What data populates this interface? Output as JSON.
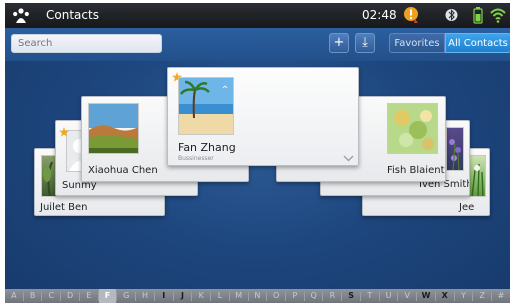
{
  "statusbar": {
    "title": "Contacts",
    "time": "02:48",
    "icons": [
      "contacts-app-icon",
      "alert-icon",
      "bluetooth-icon",
      "battery-icon",
      "wifi-icon"
    ]
  },
  "toolbar": {
    "search_placeholder": "Search",
    "add_label": "+",
    "import_label": "⤓",
    "tabs": [
      {
        "label": "Favorites",
        "selected": false
      },
      {
        "label": "All Contacts",
        "selected": true
      }
    ]
  },
  "contacts": [
    {
      "name": "Fan Zhang",
      "subtitle": "Bussinesser",
      "starred": true,
      "photo": "beach-photo-icon"
    },
    {
      "name": "Xiaohua Chen",
      "starred": false,
      "photo": "landscape-photo-icon"
    },
    {
      "name": "Sunmy",
      "starred": true,
      "photo": "default-avatar-icon"
    },
    {
      "name": "Juilet Ben",
      "starred": false,
      "photo": "plant-photo-icon"
    },
    {
      "name": "Fish Blaient",
      "starred": false,
      "photo": "flower-photo-icon"
    },
    {
      "name": "Iven Smith",
      "starred": false,
      "photo": "lavender-photo-icon"
    },
    {
      "name": "Jee",
      "starred": false,
      "photo": "grass-photo-icon"
    }
  ],
  "index_letters": [
    "A",
    "B",
    "C",
    "D",
    "E",
    "F",
    "G",
    "H",
    "I",
    "J",
    "K",
    "L",
    "M",
    "N",
    "O",
    "P",
    "Q",
    "R",
    "S",
    "T",
    "U",
    "V",
    "W",
    "X",
    "Y",
    "Z",
    "#"
  ],
  "index_selected": "F",
  "index_bold": [
    "I",
    "J",
    "S",
    "W",
    "X"
  ],
  "colors": {
    "accent": "#1f80d0",
    "background": "#1e477f",
    "card": "#f2f3f5"
  }
}
